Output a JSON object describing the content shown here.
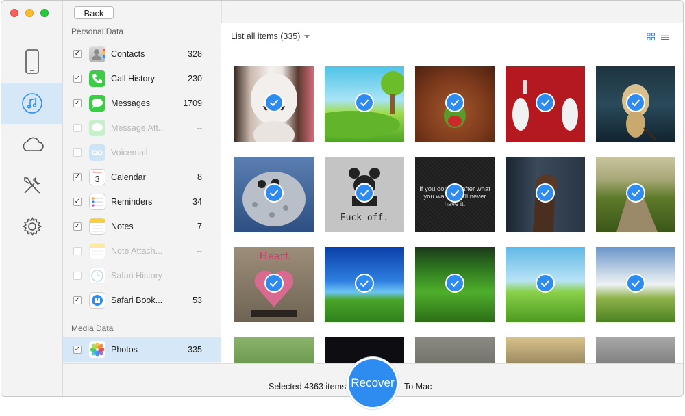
{
  "window": {
    "back_label": "Back"
  },
  "rail": {
    "items": [
      {
        "name": "device",
        "icon": "iphone-icon"
      },
      {
        "name": "itunes",
        "icon": "music-note-icon",
        "active": true
      },
      {
        "name": "icloud",
        "icon": "cloud-icon"
      },
      {
        "name": "toolkit",
        "icon": "tools-icon"
      },
      {
        "name": "settings",
        "icon": "gear-icon"
      }
    ]
  },
  "categories": {
    "personal_label": "Personal Data",
    "media_label": "Media Data",
    "personal": [
      {
        "label": "Contacts",
        "count": "328",
        "checked": "✓",
        "enabled": true,
        "icon": "contacts-icon"
      },
      {
        "label": "Call History",
        "count": "230",
        "checked": "✓",
        "enabled": true,
        "icon": "phone-icon"
      },
      {
        "label": "Messages",
        "count": "1709",
        "checked": "✓",
        "enabled": true,
        "icon": "messages-icon"
      },
      {
        "label": "Message Att...",
        "count": "--",
        "checked": "",
        "enabled": false,
        "icon": "message-attachment-icon"
      },
      {
        "label": "Voicemail",
        "count": "--",
        "checked": "",
        "enabled": false,
        "icon": "voicemail-icon"
      },
      {
        "label": "Calendar",
        "count": "8",
        "checked": "✓",
        "enabled": true,
        "icon": "calendar-icon",
        "icon_day": "Sunday",
        "icon_date": "3"
      },
      {
        "label": "Reminders",
        "count": "34",
        "checked": "✓",
        "enabled": true,
        "icon": "reminders-icon"
      },
      {
        "label": "Notes",
        "count": "7",
        "checked": "✓",
        "enabled": true,
        "icon": "notes-icon"
      },
      {
        "label": "Note Attach...",
        "count": "--",
        "checked": "",
        "enabled": false,
        "icon": "note-attachment-icon"
      },
      {
        "label": "Safari History",
        "count": "--",
        "checked": "",
        "enabled": false,
        "icon": "safari-history-icon"
      },
      {
        "label": "Safari Book...",
        "count": "53",
        "checked": "✓",
        "enabled": true,
        "icon": "safari-bookmark-icon"
      }
    ],
    "media": [
      {
        "label": "Photos",
        "count": "335",
        "checked": "✓",
        "enabled": true,
        "icon": "photos-icon",
        "selected": true
      }
    ]
  },
  "main": {
    "list_all_label": "List all items (335)",
    "photos": [
      {
        "name": "white-figurine"
      },
      {
        "name": "sky-meadow"
      },
      {
        "name": "green-bird"
      },
      {
        "name": "cartoon-squirrels"
      },
      {
        "name": "pug-violin"
      },
      {
        "name": "spotted-cat-toy"
      },
      {
        "name": "mickey-sign",
        "caption": "Fuck off."
      },
      {
        "name": "quote-dark",
        "caption": "If you don't go after what you want, you'll never have it."
      },
      {
        "name": "hand-phone"
      },
      {
        "name": "country-road"
      },
      {
        "name": "heart-art",
        "caption": "Heart"
      },
      {
        "name": "blue-hill"
      },
      {
        "name": "green-slope"
      },
      {
        "name": "sky-field"
      },
      {
        "name": "cloud-field"
      },
      {
        "name": "partial-1"
      },
      {
        "name": "partial-2"
      },
      {
        "name": "partial-3"
      },
      {
        "name": "partial-4"
      },
      {
        "name": "partial-5"
      }
    ]
  },
  "bottom": {
    "selected_text": "Selected 4363 items",
    "recover_label": "Recover",
    "to_mac": "To Mac"
  },
  "colors": {
    "accent": "#2e8cf0",
    "selection": "#d6e8f7"
  }
}
